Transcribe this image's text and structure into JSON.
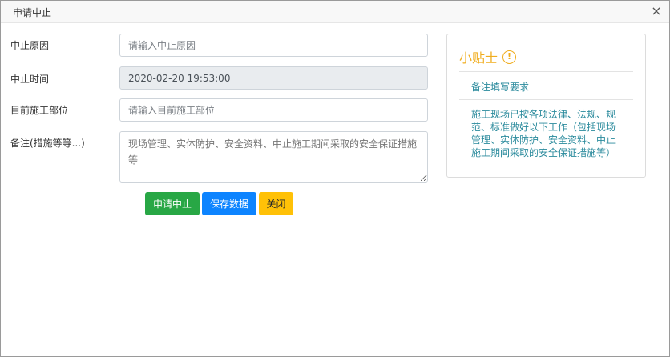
{
  "dialog": {
    "title": "申请中止",
    "close_glyph": "×"
  },
  "form": {
    "reason": {
      "label": "中止原因",
      "value": "",
      "placeholder": "请输入中止原因"
    },
    "time": {
      "label": "中止时间",
      "value": "2020-02-20 19:53:00"
    },
    "location": {
      "label": "目前施工部位",
      "value": "",
      "placeholder": "请输入目前施工部位"
    },
    "remark": {
      "label": "备注(措施等等...)",
      "placeholder": "现场管理、实体防护、安全资料、中止施工期间采取的安全保证措施等"
    }
  },
  "buttons": {
    "apply": "申请中止",
    "save": "保存数据",
    "close": "关闭"
  },
  "tips": {
    "title": "小贴士",
    "icon": "exclamation-circle-icon",
    "subtitle": "备注填写要求",
    "body": "施工现场已按各项法律、法规、规范、标准做好以下工作（包括现场管理、实体防护、安全资料、中止施工期间采取的安全保证措施等）"
  },
  "colors": {
    "green": "#28a745",
    "blue": "#0d84ff",
    "yellow": "#ffc107",
    "tip_title": "#f0ad1e",
    "tip_text": "#2a8a9c"
  }
}
